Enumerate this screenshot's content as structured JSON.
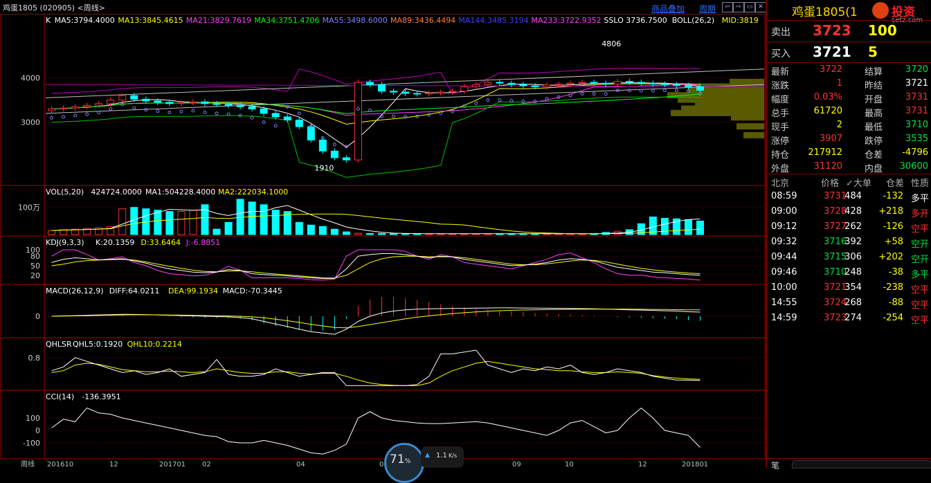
{
  "topbar": {
    "title": "鸡蛋1805 (020905) <周线>",
    "link_overlay": "商品叠加",
    "link_period": "周期",
    "btns": [
      "⇦",
      "⇨",
      "▭",
      "✕"
    ]
  },
  "chart_data": {
    "type": "candlestick",
    "period": "周线",
    "main": {
      "indicator_text": [
        "K",
        "MA5:3794.4000",
        "MA13:3845.4615",
        "MA21:3829.7619",
        "MA34:3751.4706",
        "MA55:3498.6000",
        "MA89:3436.4494",
        "MA144:3485.3194",
        "MA233:3722.9352",
        "SSLO 3736.7500",
        "BOLL(26,2)",
        "MID:3819"
      ],
      "indicator_colors": [
        "#ffffff",
        "#ffffff",
        "#ffff00",
        "#ff40ff",
        "#00ff00",
        "#8080ff",
        "#ff8040",
        "#4040ff",
        "#ff40ff",
        "#ffffff",
        "#ffffff",
        "#ffff00"
      ],
      "yticks": [
        "4000",
        "3000"
      ],
      "ylim": [
        1700,
        5100
      ],
      "annotation_high": "4806",
      "annotation_low": "1910",
      "closes": [
        3300,
        3320,
        3350,
        3380,
        3420,
        3500,
        3600,
        3520,
        3480,
        3450,
        3420,
        3440,
        3460,
        3420,
        3400,
        3380,
        3350,
        3300,
        3200,
        3120,
        3050,
        2900,
        2600,
        2350,
        2200,
        2150,
        3900,
        3850,
        3700,
        3680,
        3650,
        3640,
        3660,
        3680,
        3700,
        3800,
        3850,
        3900,
        3880,
        3850,
        3820,
        3800,
        3840,
        3860,
        3880,
        3900,
        3880,
        3860,
        3920,
        3900,
        3880,
        3860,
        3850,
        3830,
        3800,
        3720
      ]
    },
    "vol": {
      "indicator_text": [
        "VOL(5,20)",
        "424724.0000",
        "MA1:504228.4000",
        "MA2:222034.1000"
      ],
      "indicator_colors": [
        "#ffffff",
        "#ffffff",
        "#ffffff",
        "#ffff00"
      ],
      "ytick": "100万",
      "values": [
        15,
        18,
        20,
        22,
        25,
        30,
        95,
        100,
        95,
        90,
        85,
        85,
        90,
        110,
        20,
        45,
        130,
        120,
        110,
        90,
        85,
        45,
        35,
        30,
        20,
        10,
        5,
        4,
        4,
        4,
        3,
        3,
        3,
        3,
        3,
        3,
        3,
        3,
        3,
        3,
        3,
        3,
        3,
        3,
        3,
        3,
        3,
        8,
        12,
        18,
        40,
        65,
        60,
        58,
        55,
        50
      ]
    },
    "kdj": {
      "indicator_text": [
        "KDJ(9,3,3)",
        "K:20.1359",
        "D:33.6464",
        "J:-6.8851"
      ],
      "indicator_colors": [
        "#ffffff",
        "#ffffff",
        "#ffff00",
        "#ff40ff"
      ],
      "yticks": [
        "100",
        "80",
        "50",
        "20"
      ],
      "k": [
        60,
        70,
        75,
        72,
        68,
        70,
        72,
        65,
        58,
        48,
        40,
        35,
        30,
        28,
        30,
        38,
        35,
        25,
        22,
        20,
        18,
        15,
        12,
        10,
        10,
        40,
        80,
        85,
        88,
        88,
        85,
        80,
        75,
        80,
        78,
        70,
        65,
        60,
        55,
        50,
        52,
        55,
        60,
        68,
        72,
        70,
        65,
        55,
        45,
        40,
        35,
        30,
        28,
        25,
        22,
        20
      ],
      "d": [
        50,
        55,
        62,
        66,
        68,
        69,
        70,
        68,
        62,
        55,
        48,
        42,
        36,
        32,
        31,
        33,
        34,
        31,
        27,
        24,
        21,
        18,
        15,
        12,
        11,
        20,
        40,
        60,
        72,
        78,
        80,
        80,
        78,
        78,
        78,
        75,
        70,
        65,
        60,
        55,
        53,
        53,
        56,
        60,
        65,
        68,
        67,
        62,
        55,
        48,
        42,
        37,
        33,
        30,
        27,
        25
      ],
      "j": [
        80,
        100,
        100,
        85,
        68,
        72,
        78,
        60,
        50,
        35,
        25,
        22,
        18,
        20,
        30,
        48,
        36,
        12,
        12,
        12,
        12,
        10,
        6,
        5,
        8,
        80,
        100,
        100,
        100,
        100,
        95,
        80,
        70,
        85,
        78,
        60,
        55,
        50,
        45,
        40,
        50,
        60,
        70,
        85,
        90,
        75,
        60,
        40,
        25,
        20,
        20,
        15,
        12,
        10,
        8,
        5
      ]
    },
    "macd": {
      "indicator_text": [
        "MACD(26,12,9)",
        "DIFF:64.0211",
        "DEA:99.1934",
        "MACD:-70.3445"
      ],
      "indicator_colors": [
        "#ffffff",
        "#ffffff",
        "#ffff00",
        "#ffffff"
      ],
      "ytick": "0",
      "diff": [
        0,
        5,
        10,
        15,
        20,
        25,
        30,
        28,
        25,
        20,
        15,
        10,
        5,
        0,
        -5,
        -10,
        -20,
        -40,
        -80,
        -120,
        -160,
        -200,
        -240,
        -260,
        -280,
        -200,
        -80,
        0,
        50,
        80,
        100,
        110,
        115,
        118,
        120,
        122,
        125,
        128,
        130,
        130,
        128,
        126,
        124,
        122,
        120,
        118,
        115,
        110,
        105,
        100,
        95,
        90,
        85,
        80,
        70,
        64
      ],
      "dea": [
        0,
        2,
        5,
        8,
        12,
        16,
        20,
        22,
        22,
        21,
        19,
        17,
        14,
        11,
        8,
        4,
        0,
        -10,
        -25,
        -45,
        -70,
        -95,
        -125,
        -150,
        -175,
        -180,
        -160,
        -130,
        -100,
        -70,
        -40,
        -15,
        5,
        25,
        40,
        55,
        68,
        78,
        86,
        92,
        96,
        100,
        103,
        105,
        107,
        108,
        109,
        110,
        110,
        109,
        108,
        106,
        104,
        102,
        100,
        99
      ],
      "hist": [
        0,
        6,
        10,
        14,
        16,
        18,
        20,
        12,
        6,
        -2,
        -8,
        -14,
        -18,
        -22,
        -26,
        -28,
        -40,
        -60,
        -110,
        -150,
        -180,
        -210,
        -230,
        -220,
        -210,
        -40,
        160,
        260,
        300,
        300,
        280,
        250,
        220,
        186,
        160,
        134,
        114,
        100,
        88,
        76,
        64,
        52,
        42,
        34,
        26,
        20,
        12,
        0,
        -10,
        -18,
        -26,
        -32,
        -38,
        -44,
        -60,
        -70
      ]
    },
    "qhlsr": {
      "indicator_text": [
        "QHLSR",
        "QHL5:0.1920",
        "QHL10:0.2214"
      ],
      "indicator_colors": [
        "#ffffff",
        "#ffffff",
        "#ffff00"
      ],
      "ytick": "0.8",
      "qhl5": [
        0.45,
        0.55,
        0.8,
        0.7,
        0.6,
        0.5,
        0.4,
        0.45,
        0.35,
        0.4,
        0.5,
        0.3,
        0.35,
        0.4,
        0.75,
        0.35,
        0.3,
        0.3,
        0.35,
        0.5,
        0.4,
        0.3,
        0.35,
        0.4,
        0.4,
        0.05,
        0.05,
        0.05,
        0.05,
        0.05,
        0.05,
        0.08,
        0.3,
        0.9,
        0.9,
        0.95,
        1.0,
        0.6,
        0.5,
        0.4,
        0.5,
        0.45,
        0.55,
        0.5,
        0.6,
        0.4,
        0.35,
        0.4,
        0.5,
        0.45,
        0.4,
        0.3,
        0.25,
        0.2,
        0.2,
        0.19
      ],
      "qhl10": [
        0.4,
        0.45,
        0.6,
        0.65,
        0.62,
        0.55,
        0.48,
        0.45,
        0.42,
        0.42,
        0.44,
        0.42,
        0.4,
        0.42,
        0.5,
        0.45,
        0.4,
        0.38,
        0.38,
        0.42,
        0.42,
        0.38,
        0.36,
        0.38,
        0.38,
        0.3,
        0.2,
        0.12,
        0.08,
        0.06,
        0.05,
        0.05,
        0.12,
        0.3,
        0.45,
        0.55,
        0.65,
        0.7,
        0.65,
        0.6,
        0.55,
        0.5,
        0.48,
        0.45,
        0.45,
        0.42,
        0.4,
        0.4,
        0.42,
        0.4,
        0.38,
        0.32,
        0.28,
        0.25,
        0.23,
        0.22
      ]
    },
    "cci": {
      "indicator_text": [
        "CCI(14)",
        "-136.3951"
      ],
      "indicator_colors": [
        "#ffffff",
        "#ffffff"
      ],
      "yticks": [
        "100",
        "0",
        "-100"
      ],
      "values": [
        20,
        90,
        70,
        180,
        140,
        130,
        100,
        80,
        60,
        40,
        20,
        0,
        -20,
        -40,
        -50,
        -90,
        -100,
        -100,
        -80,
        -100,
        -120,
        -150,
        -180,
        -190,
        -160,
        -110,
        100,
        150,
        100,
        80,
        70,
        60,
        55,
        55,
        60,
        65,
        70,
        60,
        40,
        20,
        0,
        -20,
        -40,
        0,
        60,
        80,
        30,
        -20,
        0,
        100,
        180,
        100,
        0,
        -20,
        -40,
        -136
      ]
    },
    "xticks": [
      "周线",
      "201610",
      "12",
      "201701",
      "02",
      "04",
      "06",
      "09",
      "10",
      "12",
      "201801"
    ]
  },
  "side": {
    "header_title": "鸡蛋1805(1",
    "brand": "投资",
    "brand_sub": "setz.com",
    "sell": {
      "label": "卖出",
      "price": "3723",
      "vol": "100"
    },
    "buy": {
      "label": "买入",
      "price": "3721",
      "vol": "5"
    },
    "stats": [
      {
        "l1": "最新",
        "v1": "3722",
        "c1": "red",
        "l2": "结算",
        "v2": "3720",
        "c2": "green"
      },
      {
        "l1": "涨跌",
        "v1": "1",
        "c1": "red",
        "l2": "昨结",
        "v2": "3721",
        "c2": "white"
      },
      {
        "l1": "幅度",
        "v1": "0.03%",
        "c1": "red",
        "l2": "开盘",
        "v2": "3731",
        "c2": "red"
      },
      {
        "l1": "总手",
        "v1": "61720",
        "c1": "yellow",
        "l2": "最高",
        "v2": "3731",
        "c2": "red"
      },
      {
        "l1": "现手",
        "v1": "2",
        "c1": "yellow",
        "l2": "最低",
        "v2": "3710",
        "c2": "green"
      },
      {
        "l1": "涨停",
        "v1": "3907",
        "c1": "red",
        "l2": "跌停",
        "v2": "3535",
        "c2": "green"
      },
      {
        "l1": "持仓",
        "v1": "217912",
        "c1": "yellow",
        "l2": "仓差",
        "v2": "-4796",
        "c2": "yellow"
      },
      {
        "l1": "外盘",
        "v1": "31120",
        "c1": "red",
        "l2": "内盘",
        "v2": "30600",
        "c2": "green"
      }
    ],
    "tick_header": [
      "北京",
      "价格",
      "✓大单",
      "仓差",
      "性质"
    ],
    "ticks": [
      {
        "t": "08:59",
        "p": "3731",
        "pc": "red",
        "v": "484",
        "d": "-132",
        "n": "多平",
        "nc": "white"
      },
      {
        "t": "09:00",
        "p": "3728",
        "pc": "red",
        "v": "428",
        "d": "+218",
        "n": "多开",
        "nc": "red"
      },
      {
        "t": "09:12",
        "p": "3727",
        "pc": "red",
        "v": "262",
        "d": "-126",
        "n": "空平",
        "nc": "red"
      },
      {
        "t": "09:32",
        "p": "3716",
        "pc": "green",
        "v": "392",
        "d": "+58",
        "n": "空开",
        "nc": "green"
      },
      {
        "t": "09:44",
        "p": "3715",
        "pc": "green",
        "v": "306",
        "d": "+202",
        "n": "空开",
        "nc": "green"
      },
      {
        "t": "09:46",
        "p": "3710",
        "pc": "green",
        "v": "248",
        "d": "-38",
        "n": "多平",
        "nc": "green"
      },
      {
        "t": "10:00",
        "p": "3721",
        "pc": "red",
        "v": "354",
        "d": "-238",
        "n": "空平",
        "nc": "red"
      },
      {
        "t": "14:55",
        "p": "3724",
        "pc": "red",
        "v": "268",
        "d": "-88",
        "n": "空平",
        "nc": "red"
      },
      {
        "t": "14:59",
        "p": "3723",
        "pc": "red",
        "v": "274",
        "d": "-254",
        "n": "空平",
        "nc": "red"
      }
    ],
    "bottom_label": "笔"
  },
  "overlay": {
    "gauge_pct": "71",
    "gauge_unit": "%",
    "net_speed": "1.1",
    "net_unit": "K/s"
  }
}
